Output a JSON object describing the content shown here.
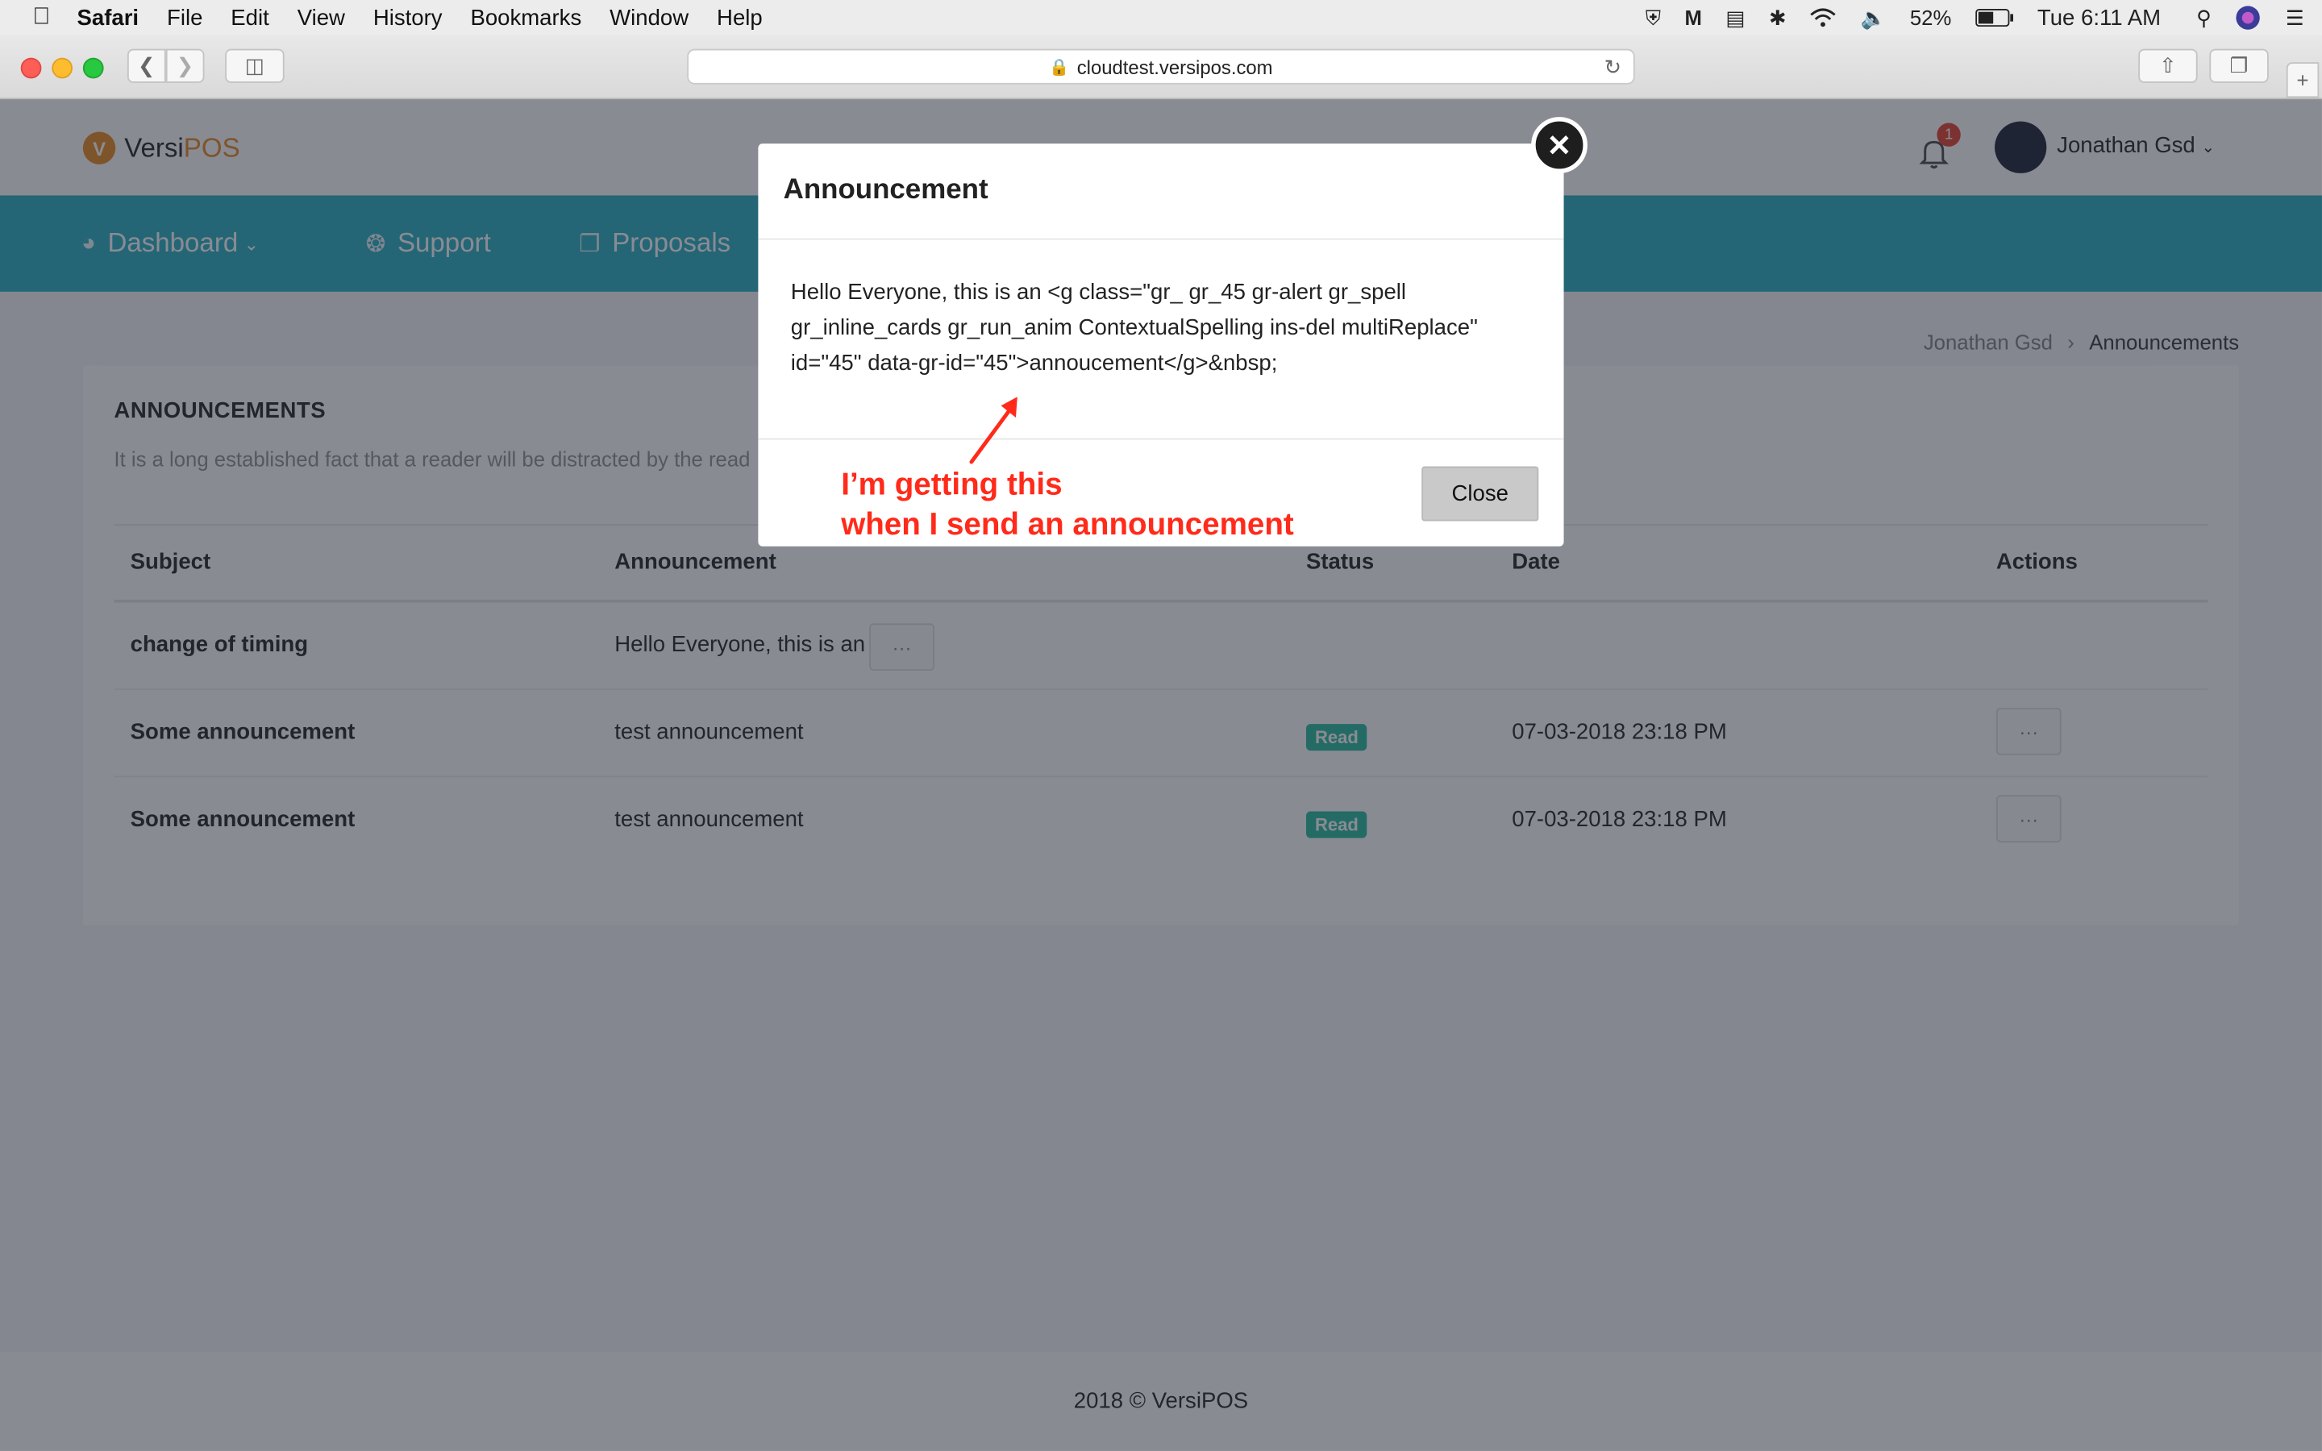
{
  "menubar": {
    "app": "Safari",
    "items": [
      "File",
      "Edit",
      "View",
      "History",
      "Bookmarks",
      "Window",
      "Help"
    ],
    "battery": "52%",
    "clock": "Tue 6:11 AM"
  },
  "browser": {
    "url": "cloudtest.versipos.com"
  },
  "header": {
    "logo_a": "Versi",
    "logo_b": "POS",
    "notification_count": "1",
    "user_name": "Jonathan Gsd"
  },
  "nav": {
    "items": [
      {
        "label": "Dashboard"
      },
      {
        "label": "Support"
      },
      {
        "label": "Proposals"
      }
    ]
  },
  "breadcrumb": {
    "parent": "Jonathan Gsd",
    "current": "Announcements"
  },
  "card": {
    "title": "ANNOUNCEMENTS",
    "description": "It is a long established fact that a reader will be distracted by the read"
  },
  "table": {
    "columns": [
      "Subject",
      "Announcement",
      "Status",
      "Date",
      "Actions"
    ],
    "rows": [
      {
        "subject": "change of timing",
        "announcement": "Hello Everyone, this is an",
        "status": "",
        "date": ""
      },
      {
        "subject": "Some announcement",
        "announcement": "test announcement",
        "status": "Read",
        "date": "07-03-2018 23:18 PM"
      },
      {
        "subject": "Some announcement",
        "announcement": "test announcement",
        "status": "Read",
        "date": "07-03-2018 23:18 PM"
      }
    ],
    "more_label": "···"
  },
  "footer": {
    "text": "2018 © VersiPOS"
  },
  "modal": {
    "title": "Announcement",
    "body": "Hello Everyone, this is an <g class=\"gr_ gr_45 gr-alert gr_spell gr_inline_cards gr_run_anim ContextualSpelling ins-del multiReplace\" id=\"45\" data-gr-id=\"45\">annoucement</g>&nbsp;",
    "close_label": "Close",
    "x_label": "✕"
  },
  "annotation": {
    "line1": "I’m getting this",
    "line2": "when I send an announcement"
  },
  "colors": {
    "accent": "#35b5c4",
    "brand": "#e8912c",
    "read_badge": "#34bfa3",
    "annotation": "#ff2a1a"
  }
}
